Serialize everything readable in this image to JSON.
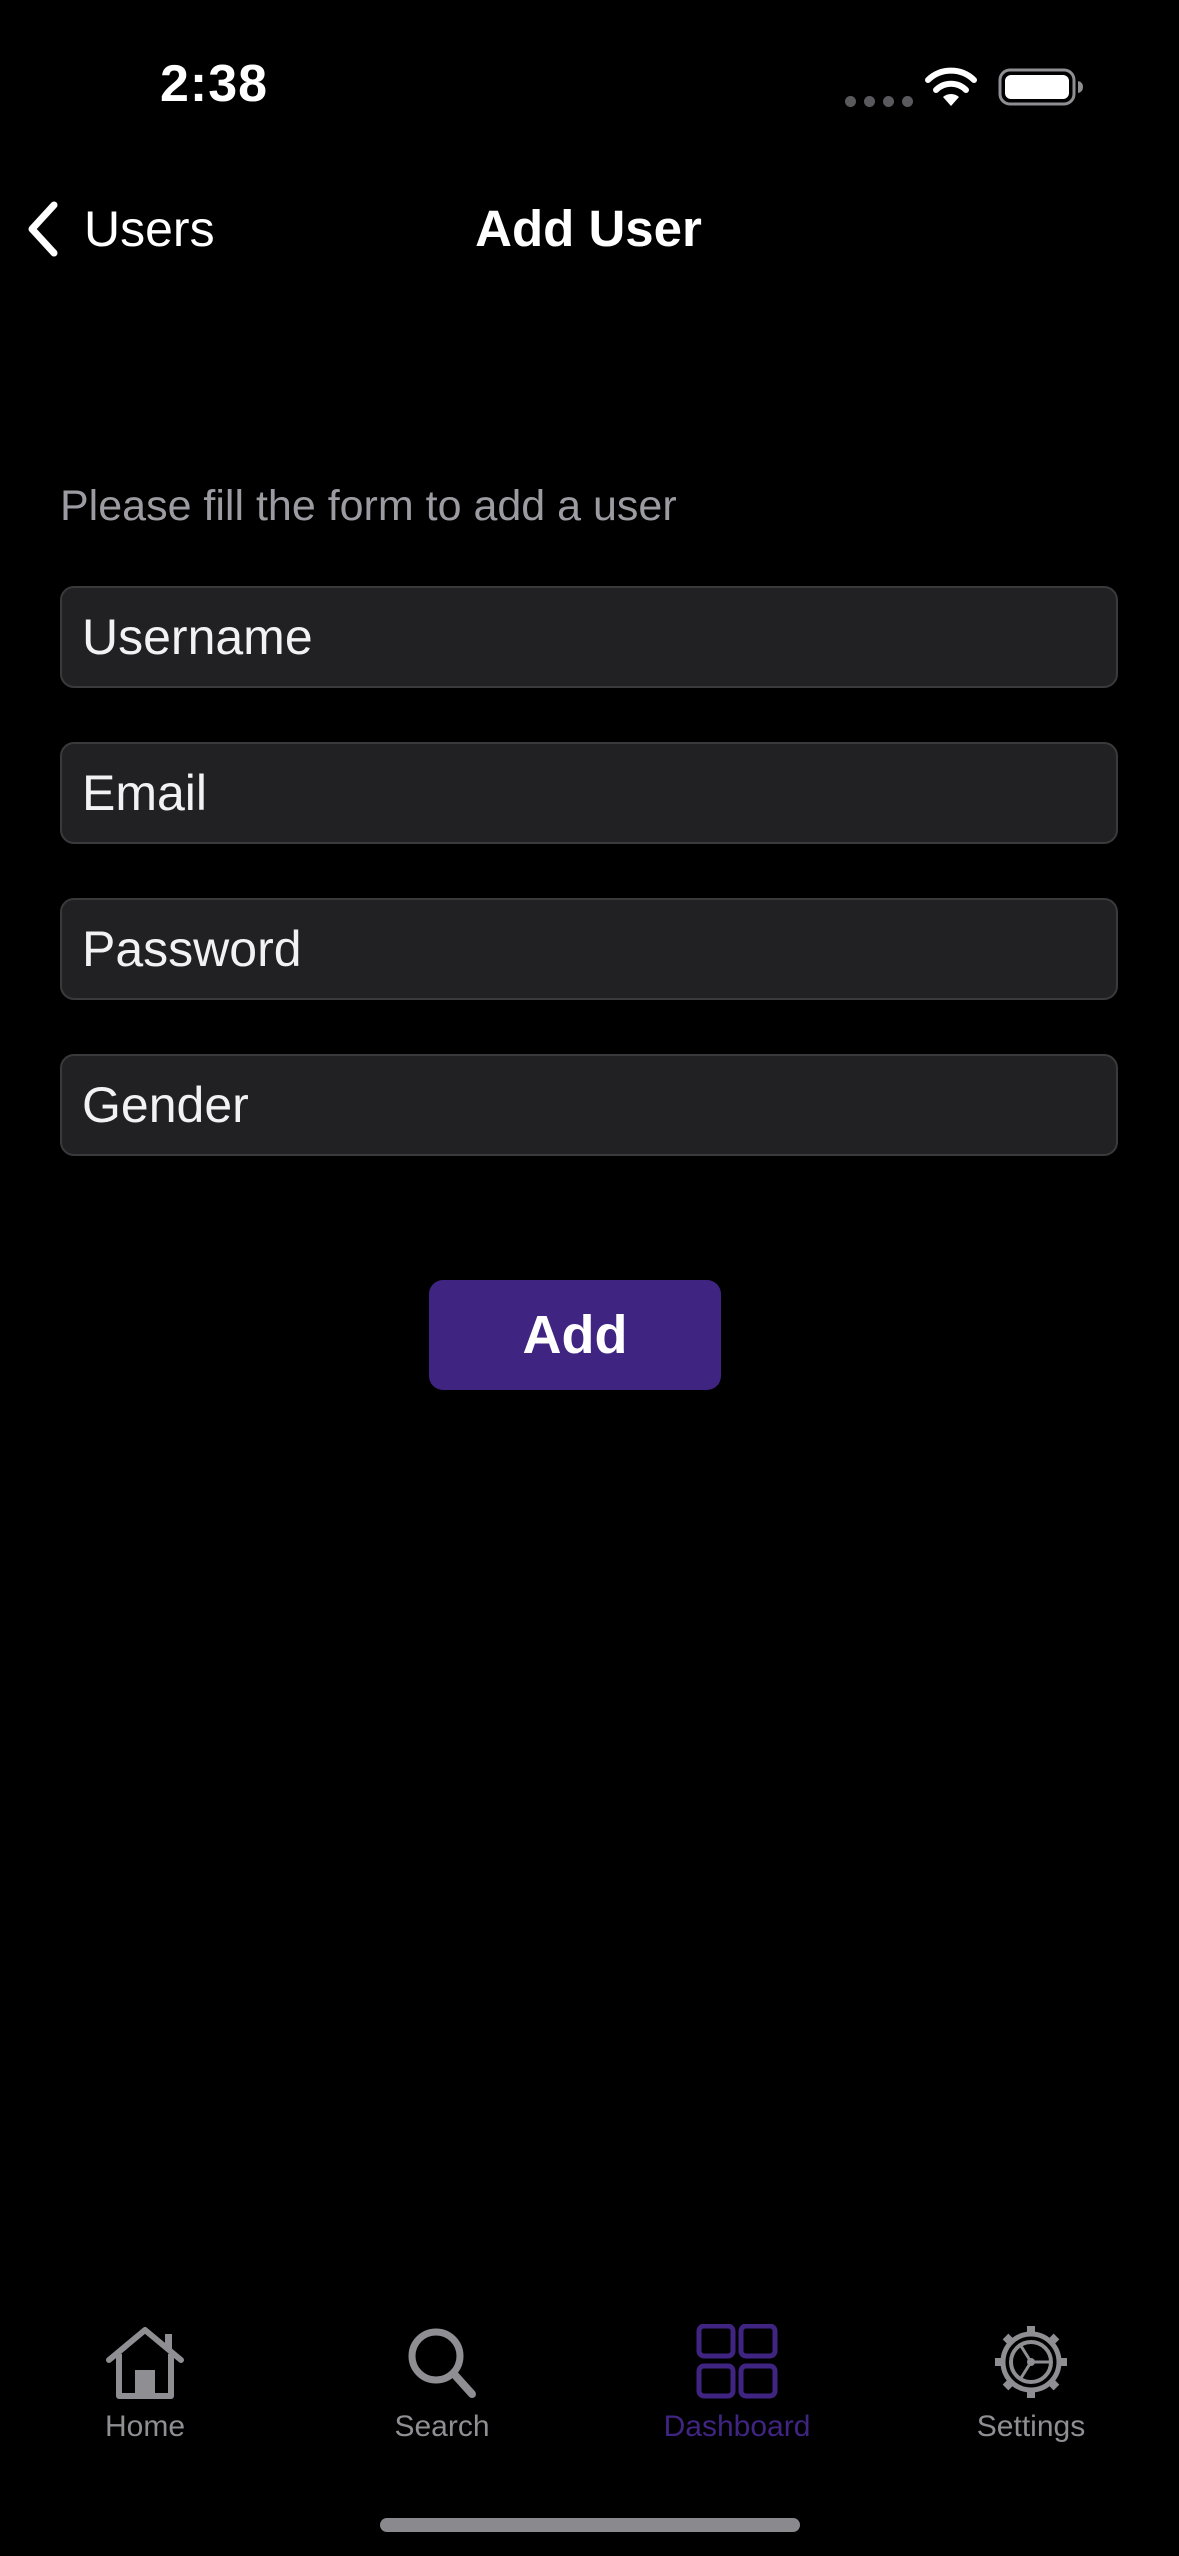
{
  "status_bar": {
    "time": "2:38"
  },
  "nav": {
    "back_label": "Users",
    "title": "Add User"
  },
  "form": {
    "subtitle": "Please fill the form to add a user",
    "fields": [
      {
        "placeholder": "Username",
        "value": ""
      },
      {
        "placeholder": "Email",
        "value": ""
      },
      {
        "placeholder": "Password",
        "value": ""
      },
      {
        "placeholder": "Gender",
        "value": ""
      }
    ],
    "submit_label": "Add"
  },
  "tab_bar": {
    "tabs": [
      {
        "label": "Home",
        "icon": "house-icon",
        "active": false
      },
      {
        "label": "Search",
        "icon": "magnifier-icon",
        "active": false
      },
      {
        "label": "Dashboard",
        "icon": "grid-icon",
        "active": true
      },
      {
        "label": "Settings",
        "icon": "gear-icon",
        "active": false
      }
    ]
  },
  "colors": {
    "background": "#000000",
    "field_background": "#212124",
    "accent": "#3f2482",
    "inactive_tab": "#8e8e93",
    "subtitle": "#9b9ba1"
  }
}
